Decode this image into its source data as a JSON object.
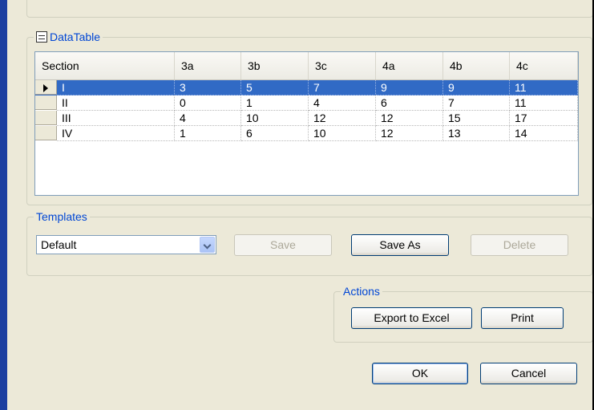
{
  "datatable": {
    "title": "DataTable",
    "columns": [
      "Section",
      "3a",
      "3b",
      "3c",
      "4a",
      "4b",
      "4c"
    ],
    "rows": [
      [
        "I",
        "3",
        "5",
        "7",
        "9",
        "9",
        "11"
      ],
      [
        "II",
        "0",
        "1",
        "4",
        "6",
        "7",
        "11"
      ],
      [
        "III",
        "4",
        "10",
        "12",
        "12",
        "15",
        "17"
      ],
      [
        "IV",
        "1",
        "6",
        "10",
        "12",
        "13",
        "14"
      ]
    ],
    "selected_row": 0
  },
  "templates": {
    "title": "Templates",
    "selected": "Default",
    "save_label": "Save",
    "save_as_label": "Save As",
    "delete_label": "Delete"
  },
  "actions": {
    "title": "Actions",
    "export_label": "Export to Excel",
    "print_label": "Print"
  },
  "dialog": {
    "ok_label": "OK",
    "cancel_label": "Cancel"
  },
  "colors": {
    "legend": "#0046d5",
    "selection": "#316ac5",
    "window_frame": "#1c3fa0"
  }
}
